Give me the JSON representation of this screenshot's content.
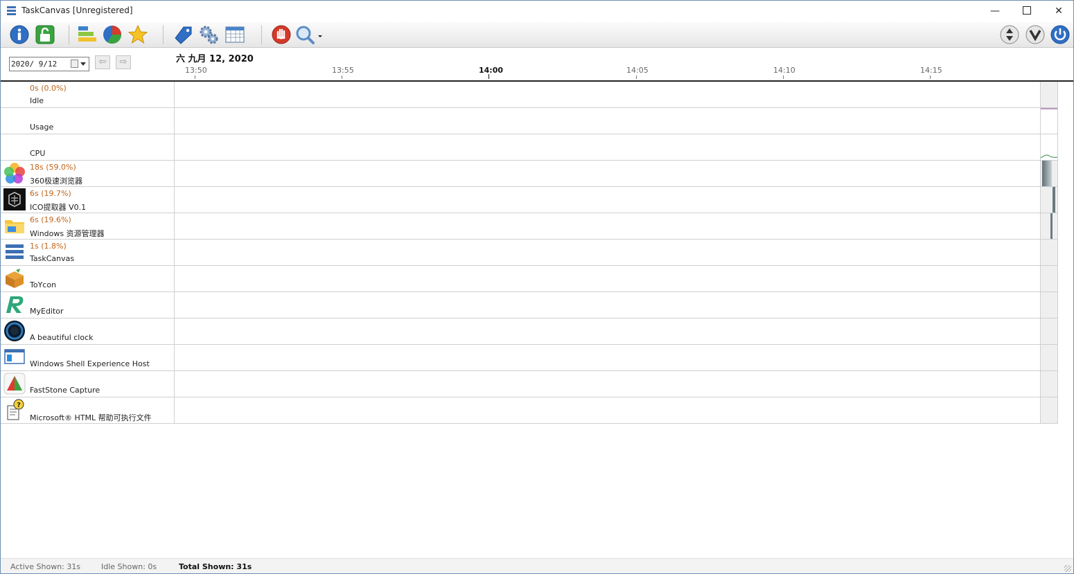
{
  "window": {
    "title": "TaskCanvas [Unregistered]",
    "minimize": "—",
    "close": "✕"
  },
  "toolbar": {
    "icons": [
      "info-icon",
      "unlock-icon",
      "stack-icon",
      "pie-chart-icon",
      "star-icon",
      "tag-icon",
      "settings-icon",
      "calendar-table-icon",
      "stop-hand-icon",
      "search-icon",
      "sort-up-down-icon",
      "chevron-down-icon",
      "power-icon"
    ]
  },
  "header": {
    "date_value": "2020/ 9/12",
    "prev_arrow": "⇦",
    "next_arrow": "⇨",
    "date_heading": "六 九月 12, 2020",
    "ticks": [
      "13:50",
      "13:55",
      "14:00",
      "14:05",
      "14:10",
      "14:15"
    ],
    "major_tick": "14:00"
  },
  "rows": [
    {
      "stat": "0s (0.0%)",
      "name": "Idle",
      "icon": "none"
    },
    {
      "stat": "",
      "name": "Usage",
      "icon": "none"
    },
    {
      "stat": "",
      "name": "CPU",
      "icon": "none"
    },
    {
      "stat": "18s (59.0%)",
      "name": "360极速浏览器",
      "icon": "browser-360-icon"
    },
    {
      "stat": "6s (19.7%)",
      "name": "ICO提取器 V0.1",
      "icon": "ico-extractor-icon"
    },
    {
      "stat": "6s (19.6%)",
      "name": "Windows 资源管理器",
      "icon": "folder-icon"
    },
    {
      "stat": "1s (1.8%)",
      "name": "TaskCanvas",
      "icon": "taskcanvas-icon"
    },
    {
      "stat": "",
      "name": "ToYcon",
      "icon": "box-icon"
    },
    {
      "stat": "",
      "name": "MyEditor",
      "icon": "editor-r-icon"
    },
    {
      "stat": "",
      "name": "A beautiful clock",
      "icon": "clock-icon"
    },
    {
      "stat": "",
      "name": "Windows Shell Experience Host",
      "icon": "window-icon"
    },
    {
      "stat": "",
      "name": "FastStone Capture",
      "icon": "capture-icon"
    },
    {
      "stat": "",
      "name": "Microsoft® HTML 帮助可执行文件",
      "icon": "help-file-icon"
    }
  ],
  "status": {
    "active": "Active Shown: 31s",
    "idle": "Idle Shown: 0s",
    "total": "Total Shown: 31s"
  },
  "colors": {
    "stat_text": "#c0651a",
    "accent_blue": "#3d6fb3",
    "stop_red": "#d23a2a"
  }
}
